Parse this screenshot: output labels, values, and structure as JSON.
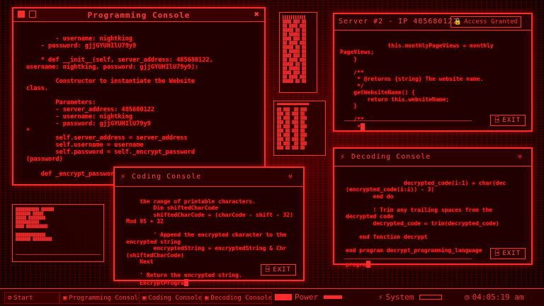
{
  "programming_console": {
    "title": "Programming Console",
    "code": "    - username: nightking\n    - password: gjjGYUHIlU79y9\n\n    * def __init__(self, server_address: 485680122,\nusername: nightking, password: gjjGYUHIlU79y9):\n\n        Constructor to instantiate the Website\nclass.\n\n        Parameters:\n        - server_address: 485680122\n        - username: nightking\n        - password: gjjGYUHIlU79y9\n*\n        self.server_address = server_address\n        self.username = username\n        self.password = self._encrypt_password\n(password)\n\n    def _encrypt_password(self, passwo"
  },
  "server_window": {
    "title": "Server #2 - IP 485680122",
    "status": "Access Granted",
    "code": "          this.monthlyPageViews = monthly\nPageViews;\n    }\n\n    /**\n     * @returns {string} The website name.\n     */\n    getWebsiteName() {\n        return this.websiteName;\n    }\n\n    /**\n     *",
    "exit_label": "EXIT"
  },
  "coding_console": {
    "title": "Coding Console",
    "code": "the range of printable characters.\n        Dim shiftedCharCode\n        shiftedCharCode = (charCode - shift - 32)\nMod 95 + 32\n\n        ' Append the encrypted character to the\nencrypted string\n        encryptedString = encryptedString & Chr\n(shiftedCharCode)\n    Next\n\n    ' Return the encrypted string.\n    EncryptProgra",
    "exit_label": "EXIT"
  },
  "decoding_console": {
    "title": "Decoding Console",
    "code": "             decrypted_code(i:1) = char(dec\n(encrypted_code(i:i)) - 3)\n        end do\n\n        ! Trim any trailing spaces from the\ndecrypted code\n        decrypted_code = trim(decrypted_code)\n\n    end function decrypt\n\nend program decrypt_programming_language\n\nprogra",
    "exit_label": "EXIT"
  },
  "taskbar": {
    "start_label": "Start",
    "items": [
      {
        "label": "Programming Console"
      },
      {
        "label": "Coding Console"
      },
      {
        "label": "Decoding Console"
      }
    ],
    "power_label": "Power",
    "system_label": "System",
    "clock": "04:05:19 am"
  },
  "colors": {
    "accent": "#ff2a2a",
    "background": "#1a0000",
    "panel": "#200000"
  }
}
